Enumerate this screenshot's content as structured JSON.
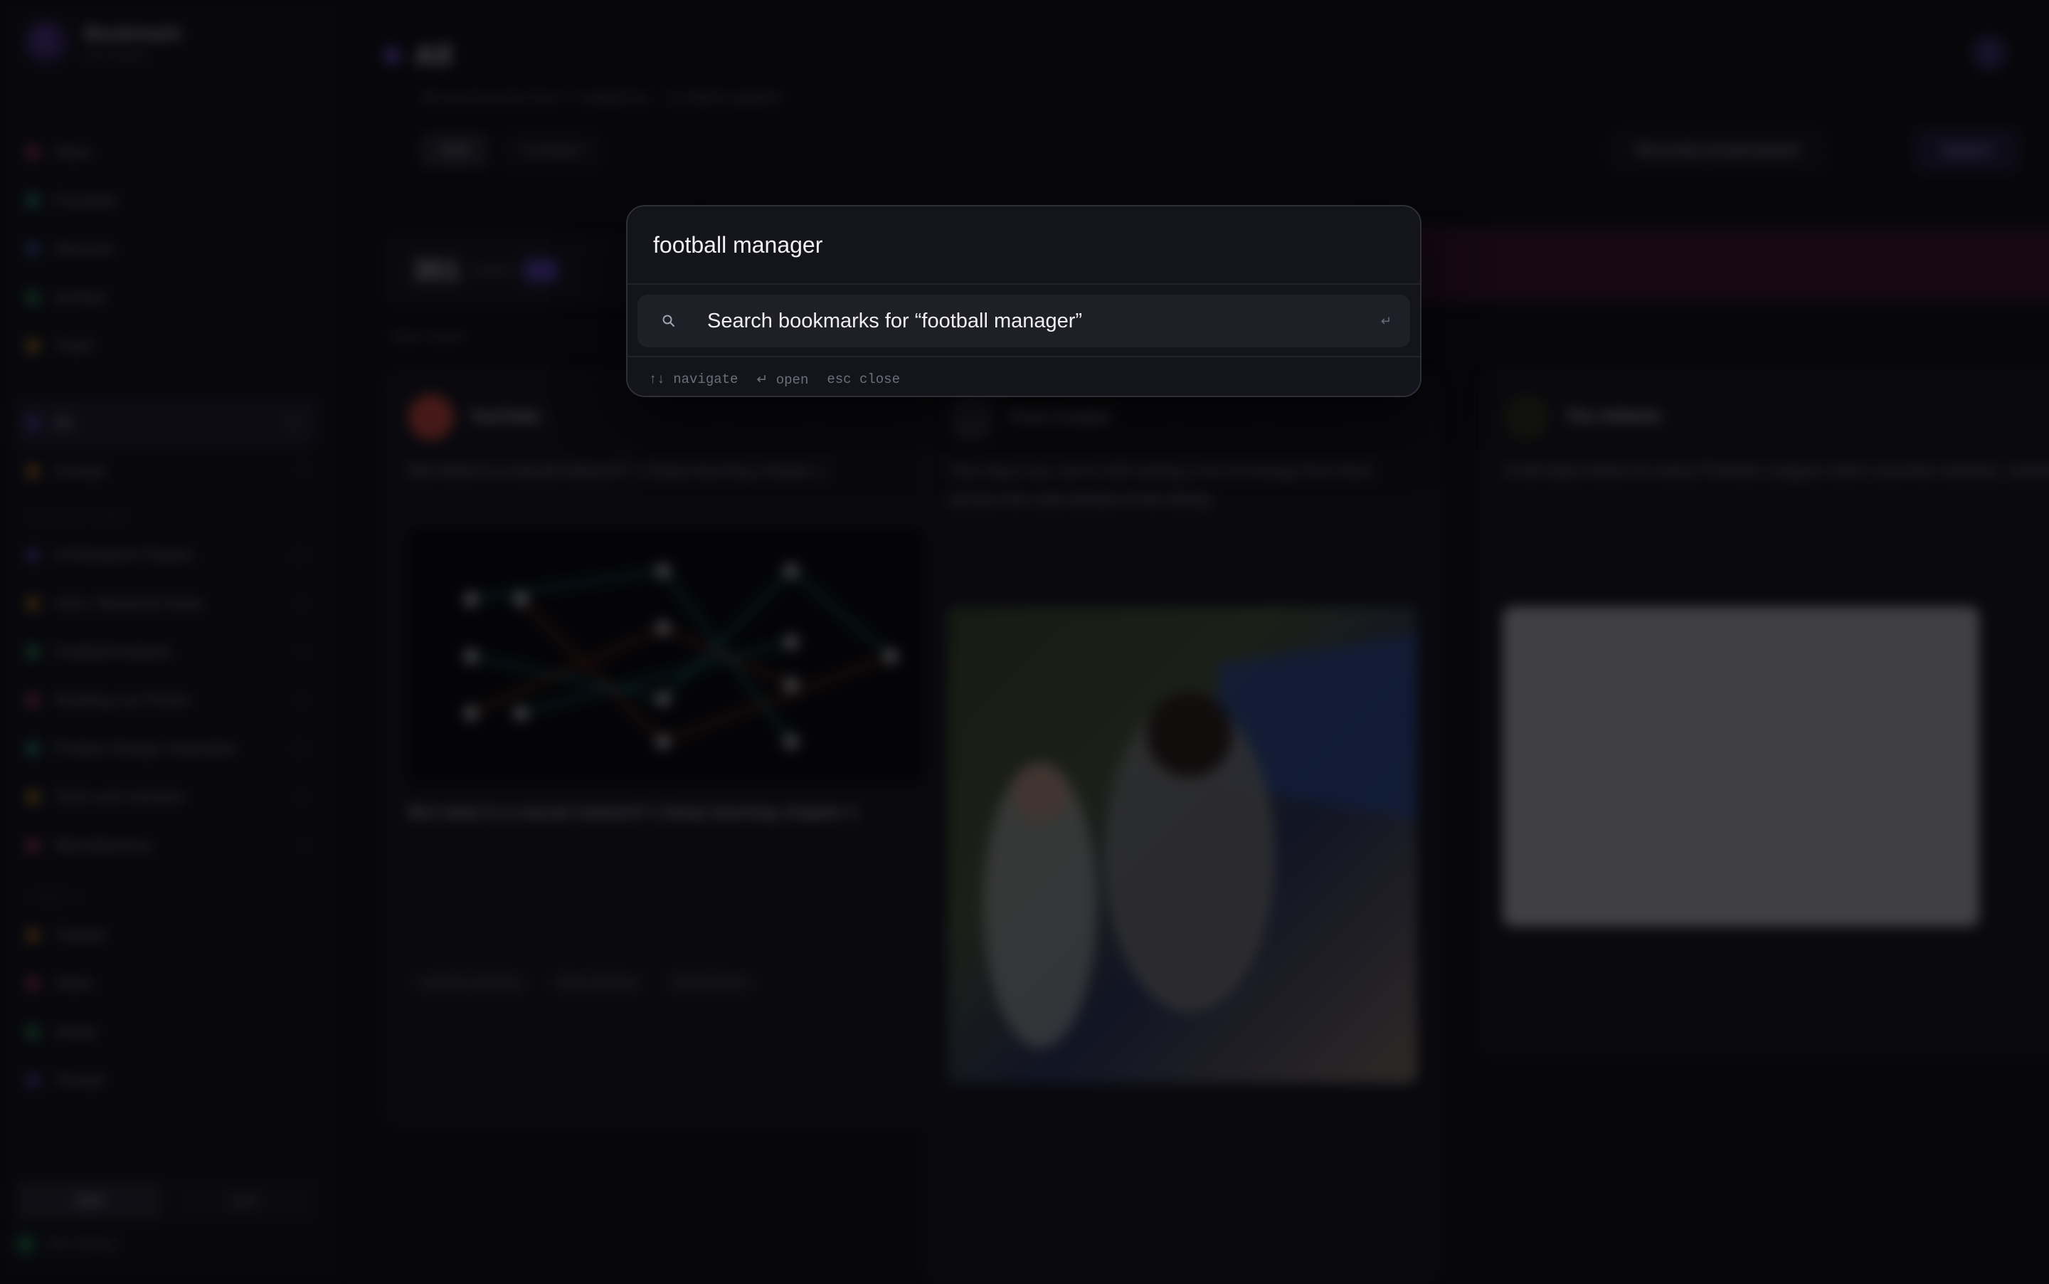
{
  "app": {
    "brand_name": "Bookmark",
    "brand_sub": "your library",
    "section_collections": "Collections",
    "section_labels": "Labels",
    "nav": [
      {
        "label": "Inbox",
        "color": "#d0455e",
        "count": ""
      },
      {
        "label": "Favorites",
        "color": "#2fb3b8",
        "count": ""
      },
      {
        "label": "Discover",
        "color": "#4a6fd8",
        "count": ""
      },
      {
        "label": "Archive",
        "color": "#2fb067",
        "count": ""
      },
      {
        "label": "Trash",
        "color": "#d9a21f",
        "count": ""
      }
    ],
    "nav2": [
      {
        "label": "All",
        "color": "#6d4bd8",
        "count": "351",
        "active": true
      },
      {
        "label": "Unread",
        "color": "#e08a1e",
        "count": "4"
      }
    ],
    "collections": [
      {
        "label": "AI Research Papers",
        "color": "#6d4bd8",
        "count": "12"
      },
      {
        "label": "Infra / Backend Notes",
        "color": "#e08a1e",
        "count": "8"
      },
      {
        "label": "Football Analysis",
        "color": "#2fb067",
        "count": "6"
      },
      {
        "label": "Reading List Fiction",
        "color": "#d0455e",
        "count": "9"
      },
      {
        "label": "Product Design Inspiration",
        "color": "#2fb3b8",
        "count": "14"
      },
      {
        "label": "Tools and Libraries",
        "color": "#d9a21f",
        "count": "5"
      },
      {
        "label": "Miscellaneous",
        "color": "#d0455e",
        "count": "3"
      }
    ],
    "labels": [
      {
        "label": "Tutorial",
        "color": "#e08a1e",
        "count": ""
      },
      {
        "label": "Video",
        "color": "#d0455e",
        "count": ""
      },
      {
        "label": "Article",
        "color": "#2fb067",
        "count": ""
      },
      {
        "label": "Thread",
        "color": "#6d4bd8",
        "count": ""
      }
    ],
    "theme_options": [
      "Dark",
      "Light"
    ],
    "user_name": "Tom Wilson"
  },
  "main": {
    "title": "All",
    "subtitle": "All saved posts from 7 categories · 12 labels applied",
    "view_tabs": [
      "Grid",
      "Compact"
    ],
    "btn_secondary": "Recently bookmarked",
    "btn_primary": "Import",
    "stats_value": "351",
    "stats_label": "saved",
    "sort_label": "Most recent",
    "cards": [
      {
        "name": "YouTube",
        "text": "But what is a neural network? | Deep learning chapter 1",
        "link_title": "But what is a neural network? | Deep learning chapter 1",
        "tags": [
          "machine learning",
          "deep learning",
          "3blue1brown"
        ]
      },
      {
        "name": "Post Creator",
        "text": "Two days out, we're still seeing a lot of energy from fans across the club ahead of the derby."
      },
      {
        "name": "The Athletic",
        "text": "A full data sheet on every Premier League club's summer window, ranked by net spend."
      }
    ]
  },
  "palette": {
    "query": "football manager",
    "placeholder": "Search bookmarks…",
    "result_label": "Search bookmarks for “football manager”",
    "result_enter": "↵",
    "search_icon": "search-icon",
    "hint_navigate": "↑↓ navigate",
    "hint_open": "↵ open",
    "hint_close": "esc close"
  }
}
